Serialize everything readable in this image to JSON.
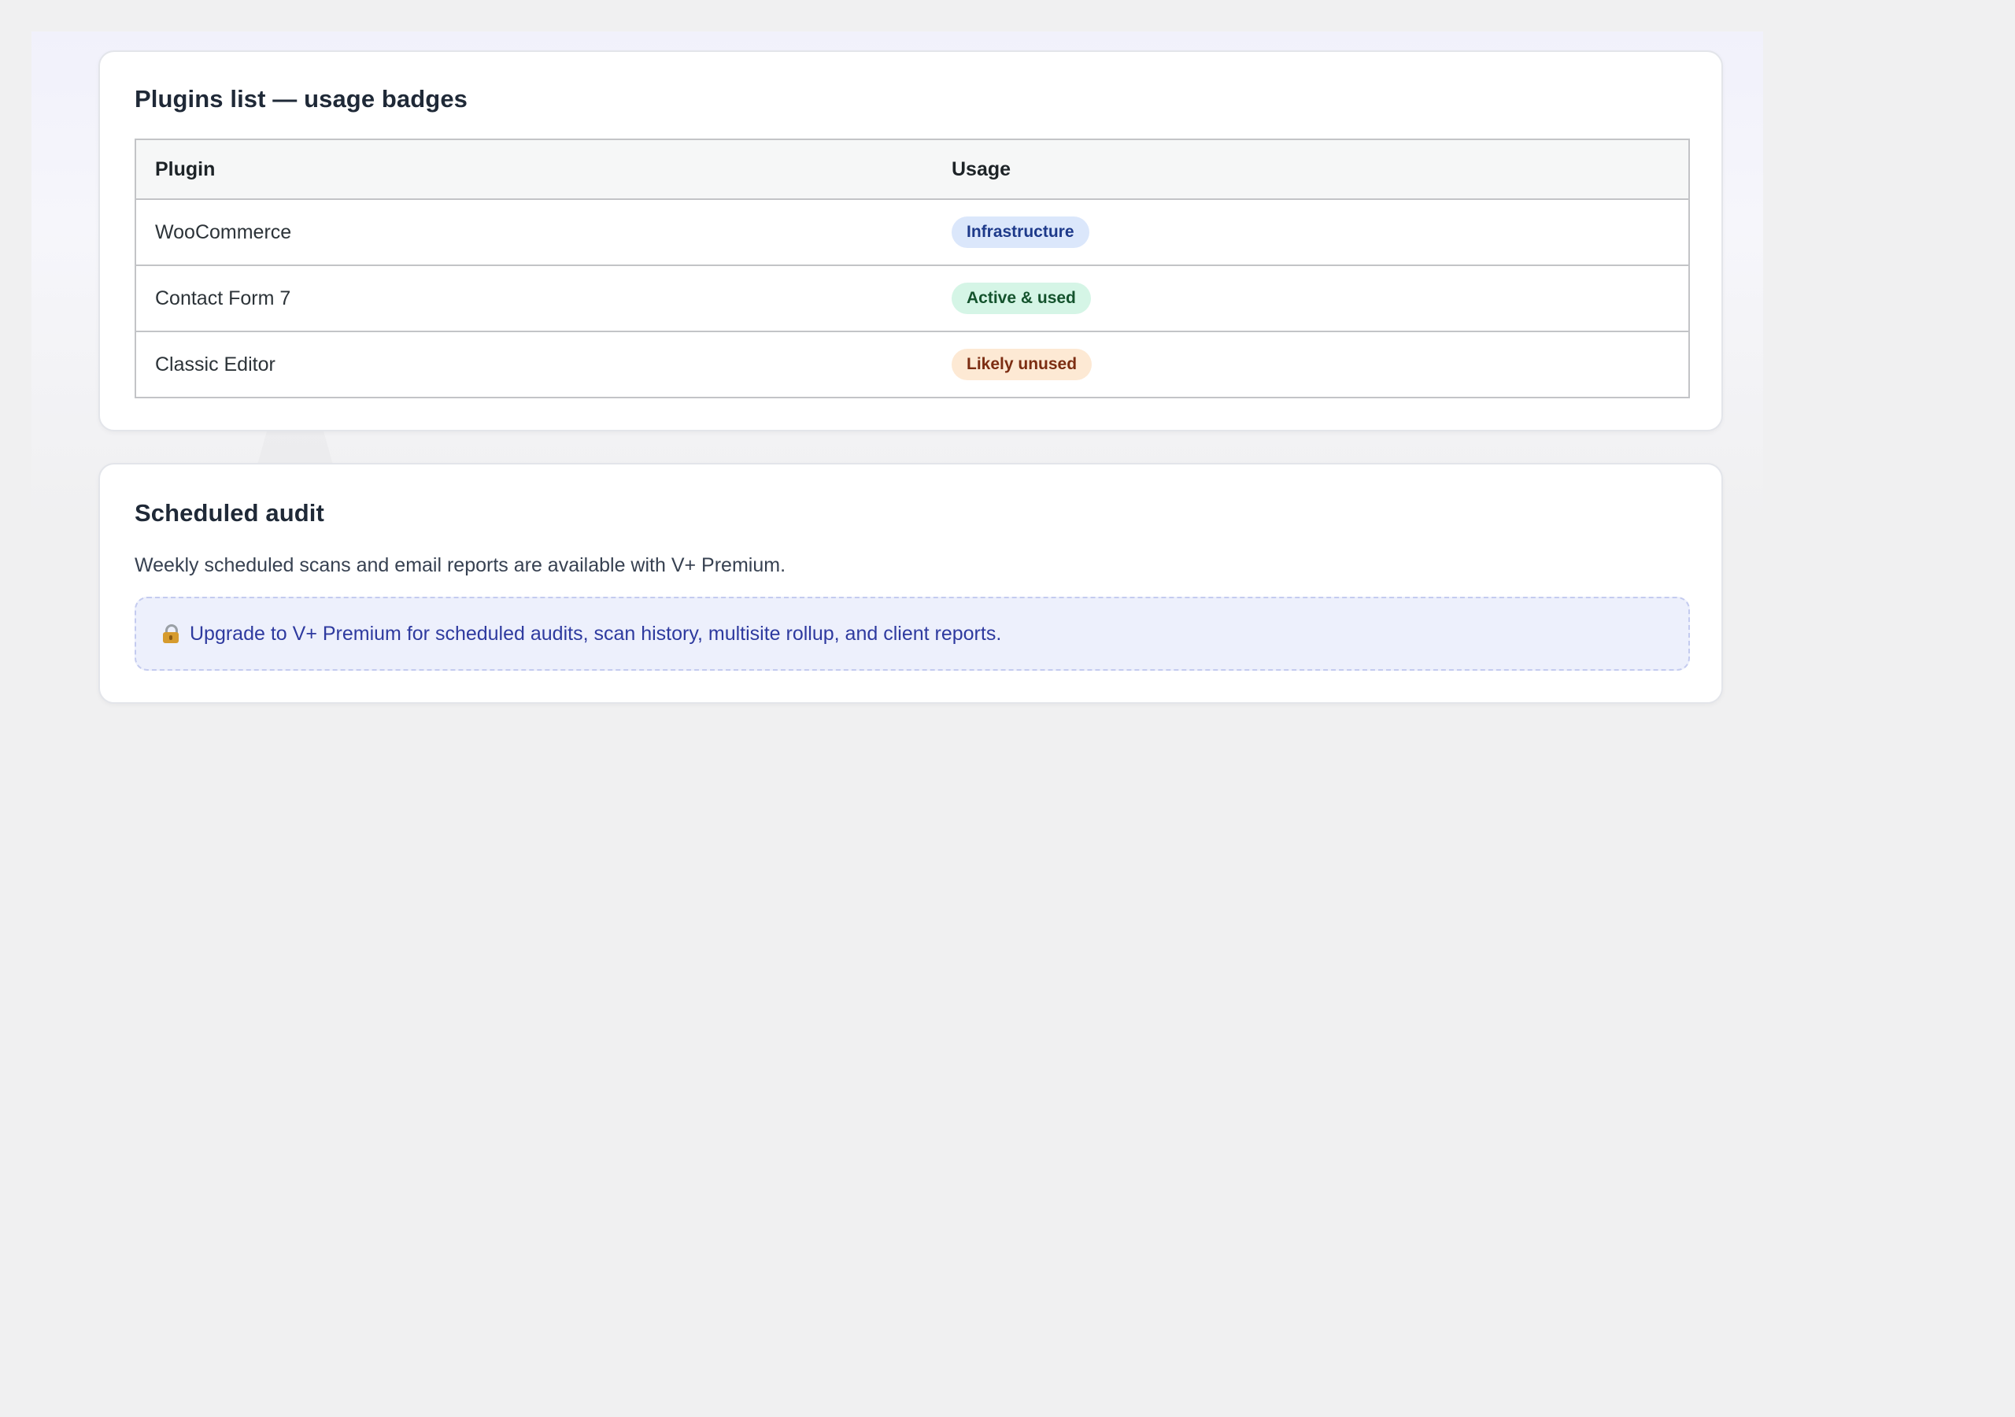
{
  "plugins_card": {
    "title": "Plugins list — usage badges",
    "columns": [
      "Plugin",
      "Usage"
    ],
    "rows": [
      {
        "plugin": "WooCommerce",
        "usage": "Infrastructure",
        "badge_color": "#dbe7fb"
      },
      {
        "plugin": "Contact Form 7",
        "usage": "Active & used",
        "badge_color": "#d5f5e6"
      },
      {
        "plugin": "Classic Editor",
        "usage": "Likely unused",
        "badge_color": "#fde9d4"
      }
    ]
  },
  "audit_card": {
    "title": "Scheduled audit",
    "description": "Weekly scheduled scans and email reports are available with V+ Premium.",
    "upsell": {
      "icon": "lock-icon",
      "text": "Upgrade to V+ Premium for scheduled audits, scan history, multisite rollup, and client reports."
    }
  },
  "colors": {
    "accent": "#2e3a9f",
    "upsell_bg": "#edf0fc"
  }
}
